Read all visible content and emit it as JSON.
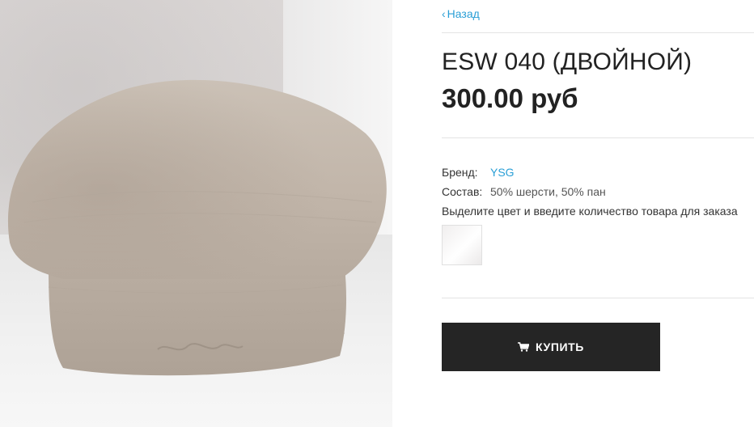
{
  "product": {
    "back_label": "Назад",
    "title": "ESW 040 (ДВОЙНОЙ)",
    "price": "300.00 руб",
    "brand_label": "Бренд:",
    "brand_value": "YSG",
    "composition_label": "Состав:",
    "composition_value": "50% шерсти, 50% пан",
    "select_hint": "Выделите цвет и введите количество товара для заказа",
    "buy_label": "КУПИТЬ"
  },
  "icons": {
    "back": "chevron-left-icon",
    "buy": "shopping-cart-icon"
  },
  "colors": {
    "link": "#2a9fd6",
    "button_bg": "#252525",
    "text": "#222222",
    "beret": "#c2b6aa"
  }
}
